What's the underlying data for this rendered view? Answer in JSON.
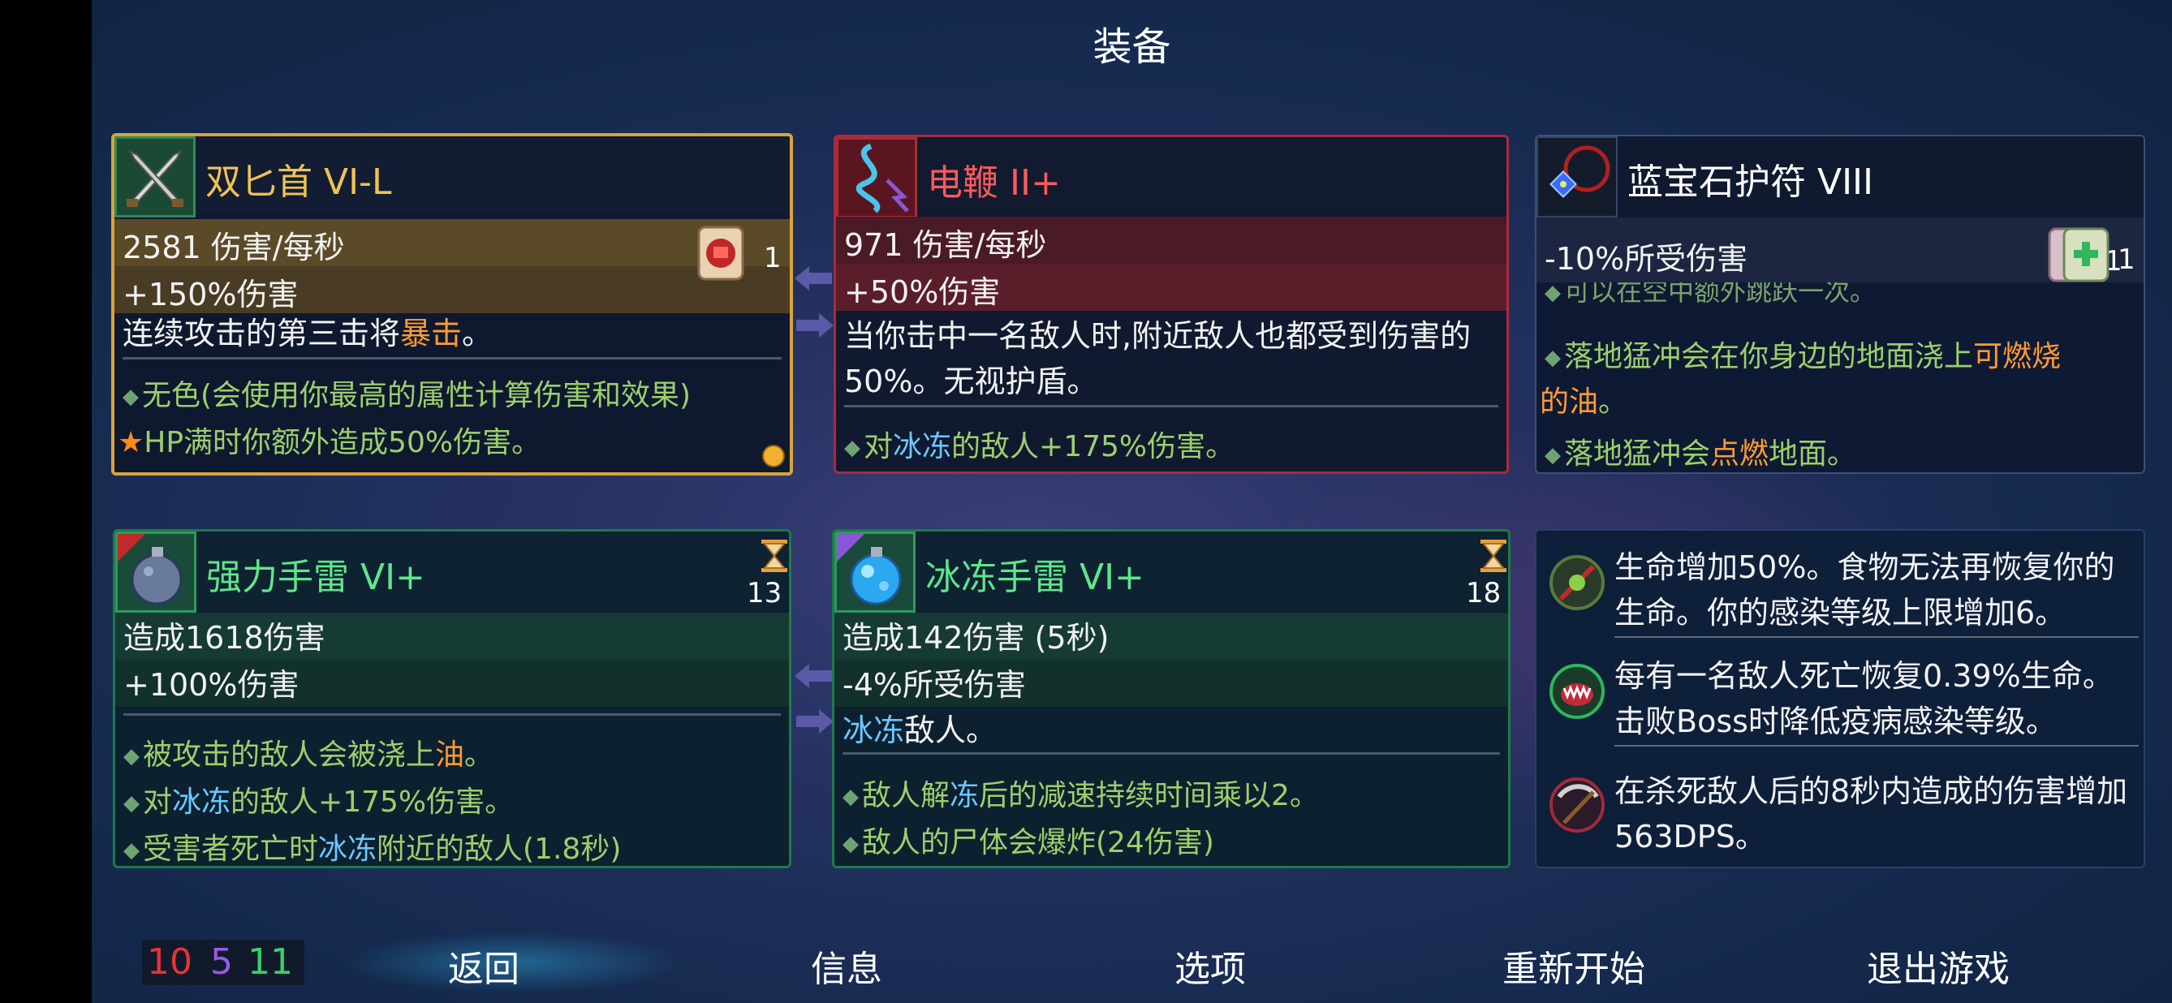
{
  "screen": {
    "title": "装备"
  },
  "weapons": {
    "dual_daggers": {
      "name": "双匕首 VI-L",
      "stat1": "2581 伤害/每秒",
      "stat2": "+150%伤害",
      "desc_a": "连续攻击的第三击将",
      "desc_b": "暴击",
      "desc_c": "。",
      "trait1": "无色(会使用你最高的属性计算伤害和效果)",
      "trait2_star": "★",
      "trait2": "HP满时你额外造成50%伤害。",
      "scroll_count": "1"
    },
    "electric_whip": {
      "name": "电鞭 II+",
      "stat1": "971 伤害/每秒",
      "stat2": "+50%伤害",
      "desc1": "当你击中一名敌人时,附近敌人也都受到伤害的",
      "desc2": "50%。无视护盾。",
      "trait1_a": "对",
      "trait1_b": "冰冻",
      "trait1_c": "的敌人+175%伤害。"
    }
  },
  "amulet": {
    "name": "蓝宝石护符 VIII",
    "stat1": "-10%所受伤害",
    "scroll1_count": "1",
    "scroll2_count": "1",
    "cut_line": "可以在空中额外跳跃一次。",
    "trait1_a": "落地猛冲会在你身边的地面浇上",
    "trait1_b": "可燃烧",
    "trait1_c": "的油",
    "trait1_d": "。",
    "trait2_a": "落地猛冲会",
    "trait2_b": "点燃",
    "trait2_c": "地面。"
  },
  "skills": {
    "power_grenade": {
      "name": "强力手雷 VI+",
      "cooldown": "13",
      "stat1": "造成1618伤害",
      "stat2": "+100%伤害",
      "trait1_a": "被攻击的敌人会被浇上",
      "trait1_b": "油",
      "trait1_c": "。",
      "trait2_a": "对",
      "trait2_b": "冰冻",
      "trait2_c": "的敌人+175%伤害。",
      "trait3_a": "受害者死亡时",
      "trait3_b": "冰冻",
      "trait3_c": "附近的敌人(1.8秒)"
    },
    "ice_grenade": {
      "name": "冰冻手雷 VI+",
      "cooldown": "18",
      "stat1": "造成142伤害 (5秒)",
      "stat2": "-4%所受伤害",
      "desc_a": "冰冻",
      "desc_b": "敌人。",
      "trait1_a": "敌人解",
      "trait1_b": "冻",
      "trait1_c": "后的减速持续时间乘以2。",
      "trait2": "敌人的尸体会爆炸(24伤害)"
    }
  },
  "mutations": [
    {
      "icon": "infection-mutation-icon",
      "line1": "生命增加50%。食物无法再恢复你的",
      "line2": "生命。你的感染等级上限增加6。"
    },
    {
      "icon": "fanged-mouth-icon",
      "line1": "每有一名敌人死亡恢复0.39%生命。",
      "line2": "击败Boss时降低疫病感染等级。"
    },
    {
      "icon": "scythe-icon",
      "line1": "在杀死敌人后的8秒内造成的伤害增加",
      "line2": "563DPS。"
    }
  ],
  "stats": {
    "brutality": "10",
    "tactics": "5",
    "survival": "11"
  },
  "menu": {
    "back": "返回",
    "info": "信息",
    "options": "选项",
    "restart": "重新开始",
    "quit": "退出游戏"
  },
  "colors": {
    "gold": "#d8a43a",
    "red": "#a92a3c",
    "green": "#1d7a4a",
    "purple": "#8a55d8",
    "ice": "#69c9ff",
    "orange": "#ff9a33",
    "trait": "#9ccf6a"
  },
  "icons": [
    "dual-daggers-icon",
    "electric-whip-icon",
    "sapphire-amulet-icon",
    "power-grenade-icon",
    "ice-grenade-icon",
    "scroll-red-icon",
    "scroll-purple-icon",
    "scroll-green-icon",
    "hourglass-icon",
    "swap-arrow-icon"
  ]
}
